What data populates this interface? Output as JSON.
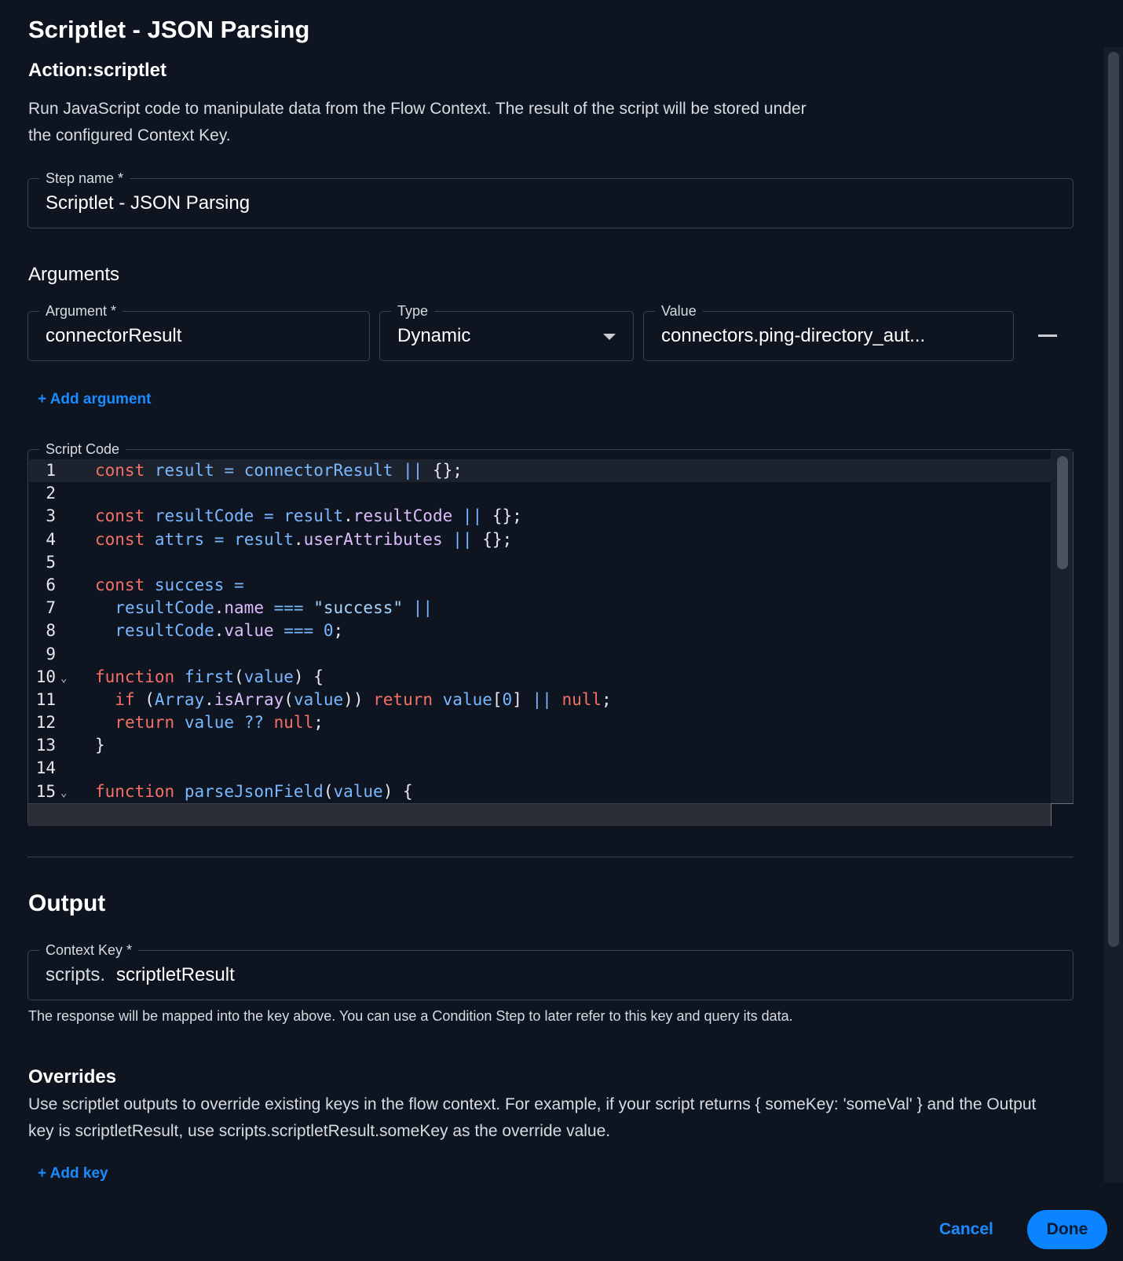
{
  "panel": {
    "title": "Scriptlet - JSON Parsing",
    "action_label": "Action:scriptlet",
    "description": "Run JavaScript code to manipulate data from the Flow Context. The result of the script will be stored under the configured Context Key."
  },
  "step_name": {
    "label": "Step name *",
    "value": "Scriptlet - JSON Parsing"
  },
  "arguments": {
    "heading": "Arguments",
    "argument": {
      "label": "Argument *",
      "value": "connectorResult"
    },
    "type": {
      "label": "Type",
      "value": "Dynamic"
    },
    "value": {
      "label": "Value",
      "value": "connectors.ping-directory_aut..."
    },
    "add_label": "+ Add argument"
  },
  "script": {
    "label": "Script Code",
    "lines": [
      {
        "n": "1",
        "code": "const result = connectorResult || {};"
      },
      {
        "n": "2",
        "code": ""
      },
      {
        "n": "3",
        "code": "const resultCode = result.resultCode || {};"
      },
      {
        "n": "4",
        "code": "const attrs = result.userAttributes || {};"
      },
      {
        "n": "5",
        "code": ""
      },
      {
        "n": "6",
        "code": "const success ="
      },
      {
        "n": "7",
        "code": "  resultCode.name === \"success\" ||"
      },
      {
        "n": "8",
        "code": "  resultCode.value === 0;"
      },
      {
        "n": "9",
        "code": ""
      },
      {
        "n": "10",
        "code": "function first(value) {",
        "fold": true
      },
      {
        "n": "11",
        "code": "  if (Array.isArray(value)) return value[0] || null;"
      },
      {
        "n": "12",
        "code": "  return value ?? null;"
      },
      {
        "n": "13",
        "code": "}"
      },
      {
        "n": "14",
        "code": ""
      },
      {
        "n": "15",
        "code": "function parseJsonField(value) {",
        "fold": true
      }
    ]
  },
  "output": {
    "heading": "Output",
    "context_key": {
      "label": "Context Key *",
      "prefix": "scripts.",
      "value": "scriptletResult"
    },
    "hint": "The response will be mapped into the key above. You can use a Condition Step to later refer to this key and query its data."
  },
  "overrides": {
    "heading": "Overrides",
    "description": "Use scriptlet outputs to override existing keys in the flow context. For example, if your script returns { someKey: 'someVal' } and the Output key is scriptletResult, use scripts.scriptletResult.someKey as the override value.",
    "add_label": "+ Add key"
  },
  "footer": {
    "cancel_label": "Cancel",
    "done_label": "Done"
  },
  "colors": {
    "background": "#0e1521",
    "accent": "#1a8cff",
    "primary_button": "#0a84ff"
  }
}
